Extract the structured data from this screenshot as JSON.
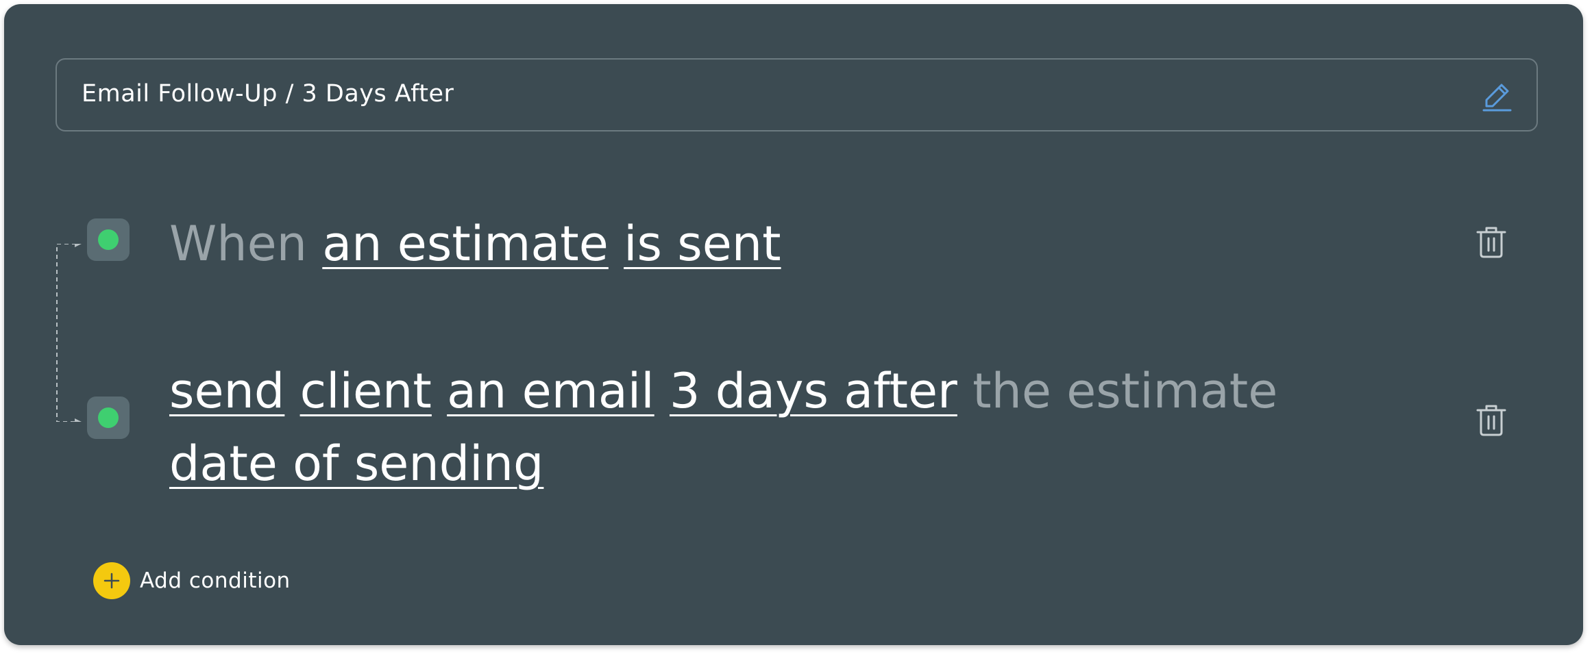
{
  "header": {
    "title": "Email Follow-Up / 3 Days After",
    "edit_icon": "pencil-icon",
    "accent_color": "#5a9bdc"
  },
  "rules": [
    {
      "parts": [
        {
          "text": "When",
          "style": "muted"
        },
        {
          "text": "an estimate",
          "style": "token"
        },
        {
          "text": "is sent",
          "style": "token"
        }
      ],
      "status_color": "#3fcf70"
    },
    {
      "line1": [
        {
          "text": "send",
          "style": "token"
        },
        {
          "text": "client",
          "style": "token"
        },
        {
          "text": "an email",
          "style": "token"
        },
        {
          "text": "3 days after",
          "style": "token"
        },
        {
          "text": "the estimate",
          "style": "muted"
        }
      ],
      "line2": [
        {
          "text": "date of sending",
          "style": "token"
        }
      ],
      "status_color": "#3fcf70"
    }
  ],
  "add_condition": {
    "label": "Add condition",
    "icon": "plus-icon",
    "color": "#f4c90f"
  },
  "delete_icon": "trash-icon"
}
